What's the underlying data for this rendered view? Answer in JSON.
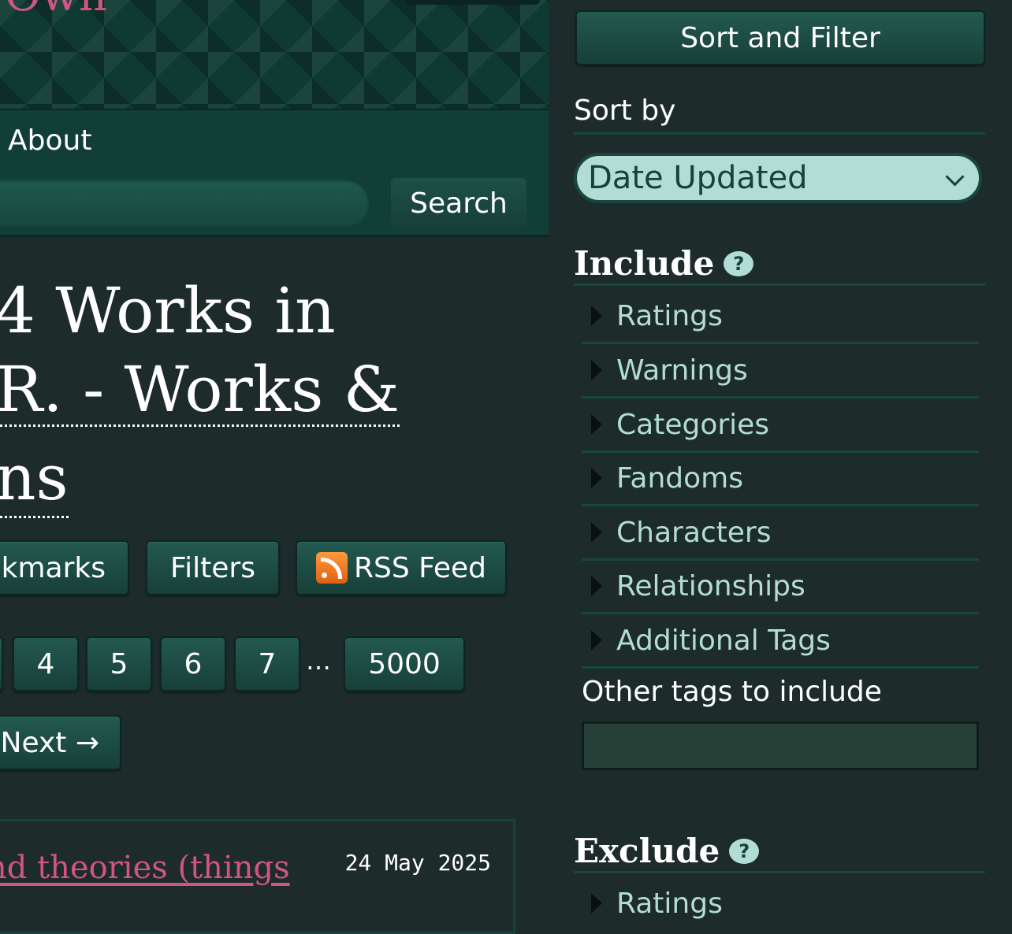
{
  "header": {
    "logo_text": "Own",
    "nav_about": "About",
    "search_button": "Search"
  },
  "heading": {
    "line1": "4 Works in",
    "line2": "R. - Works &",
    "line3": "ns"
  },
  "actions": {
    "bookmarks": "kmarks",
    "filters": "Filters",
    "rss": "RSS Feed"
  },
  "pagination": {
    "pages": [
      "4",
      "5",
      "6",
      "7"
    ],
    "gap": "…",
    "last": "5000",
    "next": "Next →"
  },
  "work": {
    "title_line1": "nd theories (things",
    "title_line2": "",
    "date": "24 May 2025"
  },
  "sidebar": {
    "header": "Sort and Filter",
    "sort_label": "Sort by",
    "sort_value": "Date Updated",
    "include_title": "Include",
    "help_glyph": "?",
    "include_facets": [
      "Ratings",
      "Warnings",
      "Categories",
      "Fandoms",
      "Characters",
      "Relationships",
      "Additional Tags"
    ],
    "other_tags_label": "Other tags to include",
    "exclude_title": "Exclude",
    "exclude_facets": [
      "Ratings"
    ]
  },
  "colors": {
    "background": "#1e2b2b",
    "accent_pink": "#d1567f",
    "facet_text": "#b2ddd4",
    "button_green": "#235a50"
  },
  "icons": [
    "rss-icon",
    "help-icon",
    "chevron-down-icon",
    "disclosure-triangle-icon"
  ]
}
